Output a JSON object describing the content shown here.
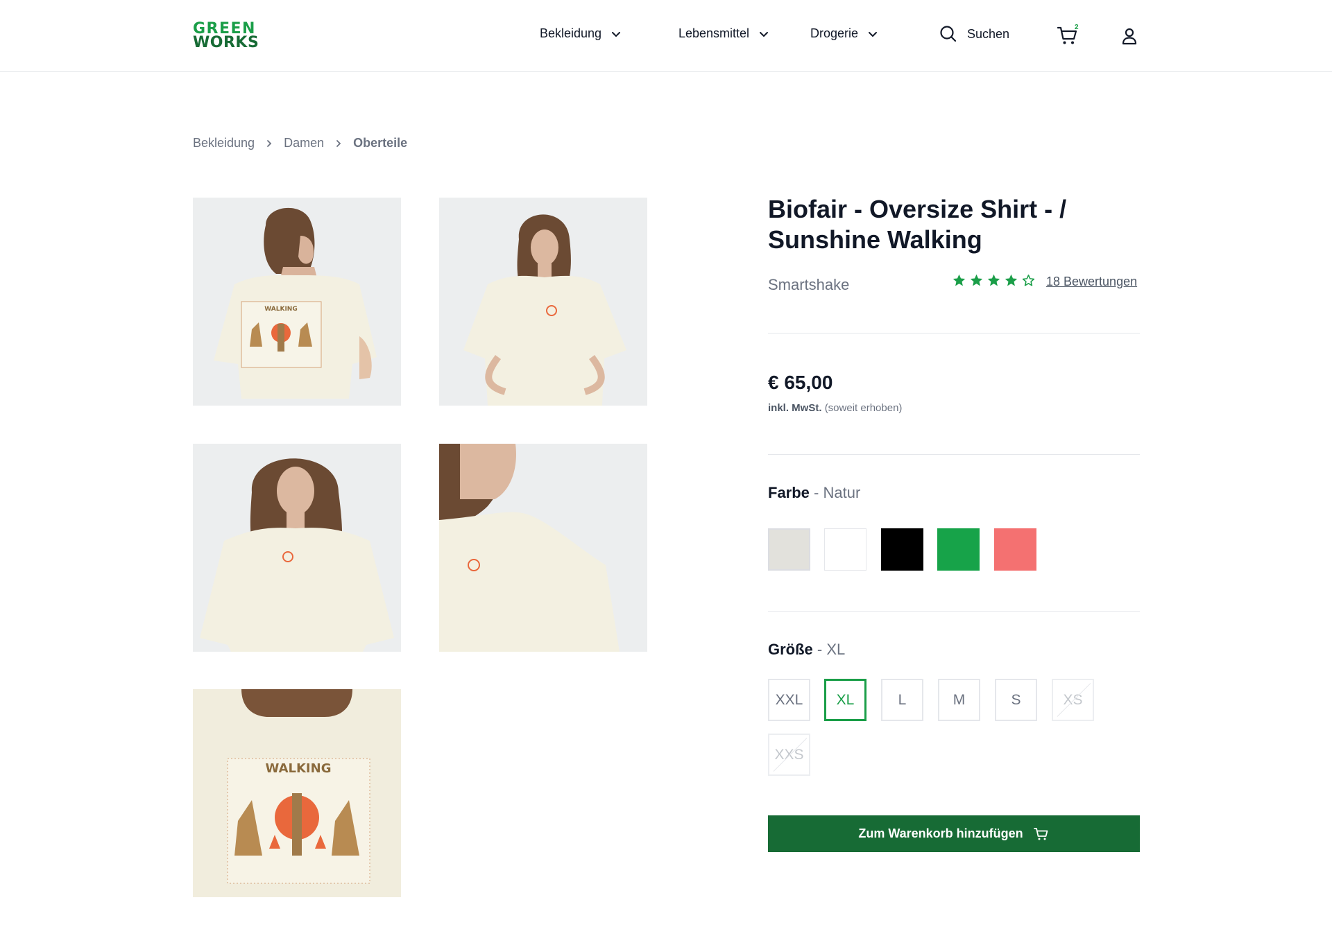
{
  "header": {
    "logo_line1": "GREEN",
    "logo_line2": "WORKS",
    "nav": [
      "Bekleidung",
      "Lebensmittel",
      "Drogerie"
    ],
    "search_label": "Suchen",
    "cart_count": "2",
    "icons": [
      "chevron-down-icon",
      "search-icon",
      "cart-icon",
      "user-icon"
    ]
  },
  "breadcrumb": [
    "Bekleidung",
    "Damen",
    "Oberteile"
  ],
  "gallery": {
    "images": [
      "back-view",
      "front-view",
      "front-view-closeup",
      "side-closeup",
      "back-print-closeup"
    ]
  },
  "product": {
    "title": "Biofair - Oversize Shirt - / Sunshine Walking",
    "brand": "Smartshake",
    "rating": 4,
    "rating_max": 5,
    "reviews_label": "18 Bewertungen",
    "price": "€ 65,00",
    "tax_bold": "inkl. MwSt.",
    "tax_note": "(soweit erhoben)",
    "color_label": "Farbe",
    "color_selected": "- Natur",
    "colors": [
      "#e2e1dc",
      "#ffffff",
      "#000000",
      "#17a349",
      "#f47171"
    ],
    "size_label": "Größe",
    "size_selected": "- XL",
    "sizes": [
      {
        "label": "XXL",
        "state": "available"
      },
      {
        "label": "XL",
        "state": "selected"
      },
      {
        "label": "L",
        "state": "available"
      },
      {
        "label": "M",
        "state": "available"
      },
      {
        "label": "S",
        "state": "available"
      },
      {
        "label": "XS",
        "state": "unavailable"
      },
      {
        "label": "XXS",
        "state": "unavailable"
      }
    ],
    "add_to_cart": "Zum Warenkorb hinzufügen",
    "accent": "#1a9e48",
    "button_color": "#176b35"
  }
}
